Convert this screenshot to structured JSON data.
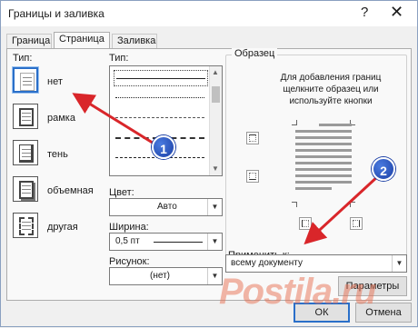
{
  "window": {
    "title": "Границы и заливка",
    "help_glyph": "?",
    "close_glyph": "✕"
  },
  "tabs": [
    {
      "label": "Граница",
      "active": false
    },
    {
      "label": "Страница",
      "active": true
    },
    {
      "label": "Заливка",
      "active": false
    }
  ],
  "type_section": {
    "label": "Тип:",
    "options": [
      {
        "label": "нет",
        "selected": true
      },
      {
        "label": "рамка",
        "selected": false
      },
      {
        "label": "тень",
        "selected": false
      },
      {
        "label": "объемная",
        "selected": false
      },
      {
        "label": "другая",
        "selected": false
      }
    ]
  },
  "style_section": {
    "label": "Тип:"
  },
  "color": {
    "label": "Цвет:",
    "value": "Авто"
  },
  "width": {
    "label": "Ширина:",
    "value": "0,5 пт"
  },
  "art": {
    "label": "Рисунок:",
    "value": "(нет)"
  },
  "preview": {
    "label": "Образец",
    "hint": "Для добавления границ щелкните образец или используйте кнопки"
  },
  "apply_to": {
    "label": "Применить к:",
    "value": "всему документу"
  },
  "buttons": {
    "options": "Параметры",
    "ok": "ОК",
    "cancel": "Отмена"
  },
  "callouts": [
    "1",
    "2"
  ],
  "watermark": "Postila.ru",
  "colors": {
    "accent": "#2a6fc9",
    "arrow": "#d9262a",
    "callout": "#1b3fa5"
  }
}
